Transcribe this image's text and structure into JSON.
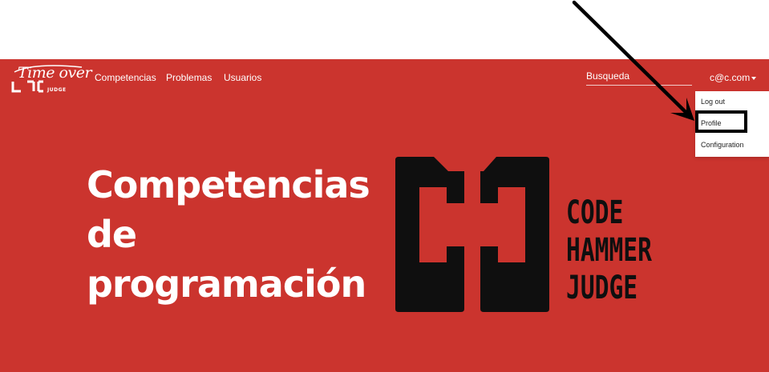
{
  "brand": {
    "logo_text": "Time over",
    "logo_subtext": "JUDGE"
  },
  "nav": {
    "links": [
      {
        "label": "Competencias"
      },
      {
        "label": "Problemas"
      },
      {
        "label": "Usuarios"
      }
    ]
  },
  "search": {
    "placeholder": "Busqueda"
  },
  "user": {
    "email": "c@c.com"
  },
  "dropdown": {
    "items": [
      {
        "label": "Log out"
      },
      {
        "label": "Profile"
      },
      {
        "label": "Configuration"
      }
    ]
  },
  "hero": {
    "title_lines": [
      "Competencias",
      "de",
      "programación"
    ]
  },
  "hero_logo": {
    "lines": [
      "CODE",
      "HAMMER",
      "JUDGE"
    ]
  },
  "colors": {
    "hero_background": "#CB342E",
    "text_light": "#FFFFFF",
    "logo_dark": "#0F0F0F",
    "annotation": "#000000"
  }
}
